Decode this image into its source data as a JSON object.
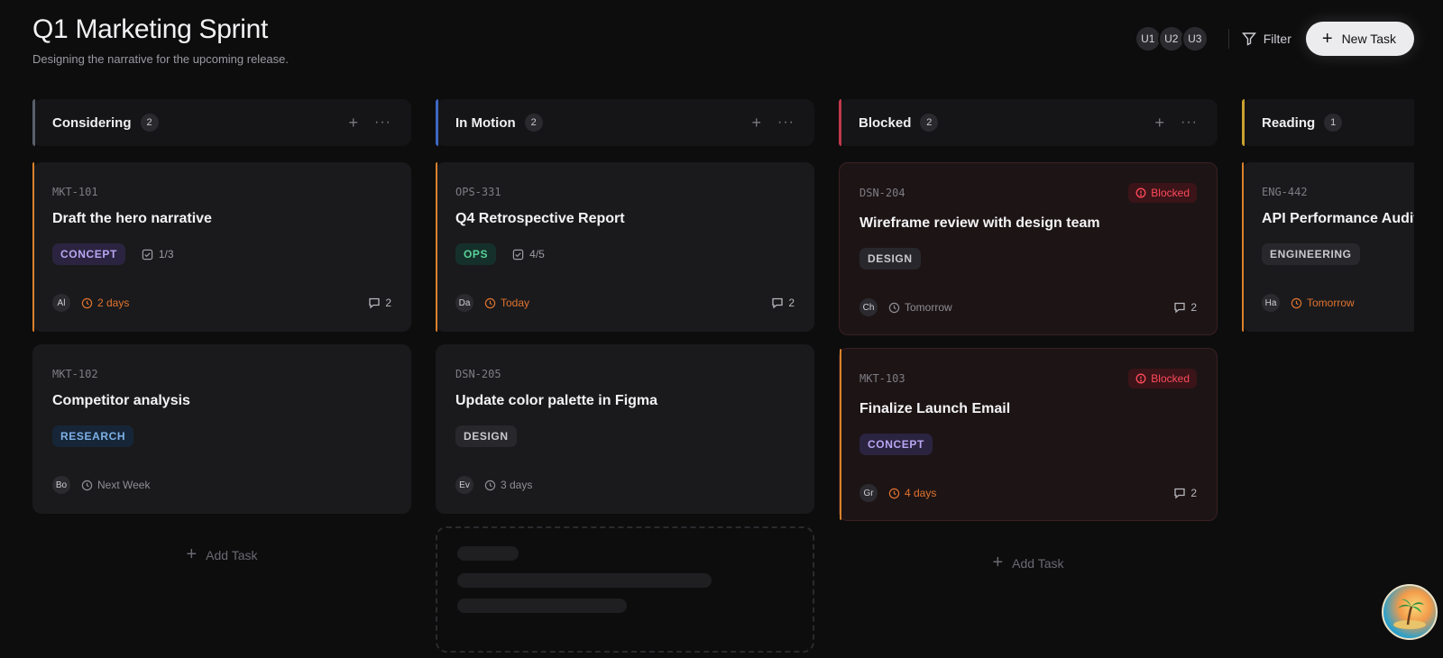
{
  "header": {
    "title": "Q1 Marketing Sprint",
    "subtitle": "Designing the narrative for the upcoming release.",
    "users": [
      "U1",
      "U2",
      "U3"
    ],
    "filter_label": "Filter",
    "new_task_label": "New Task"
  },
  "colors": {
    "considering": "#5b5f6b",
    "in_motion": "#3e68c4",
    "blocked": "#c0394b",
    "reading": "#c9a22f",
    "due_warning": "#e0732f"
  },
  "columns": [
    {
      "title": "Considering",
      "count": "2",
      "add_label": "Add Task",
      "cards": [
        {
          "id": "MKT-101",
          "title": "Draft the hero narrative",
          "tag": "CONCEPT",
          "subtasks": "1/3",
          "assignee": "Al",
          "due": "2 days",
          "comments": "2"
        },
        {
          "id": "MKT-102",
          "title": "Competitor analysis",
          "tag": "RESEARCH",
          "assignee": "Bo",
          "due": "Next Week"
        }
      ]
    },
    {
      "title": "In Motion",
      "count": "2",
      "cards": [
        {
          "id": "OPS-331",
          "title": "Q4 Retrospective Report",
          "tag": "OPS",
          "subtasks": "4/5",
          "assignee": "Da",
          "due": "Today",
          "comments": "2"
        },
        {
          "id": "DSN-205",
          "title": "Update color palette in Figma",
          "tag": "DESIGN",
          "assignee": "Ev",
          "due": "3 days"
        }
      ]
    },
    {
      "title": "Blocked",
      "count": "2",
      "add_label": "Add Task",
      "cards": [
        {
          "id": "DSN-204",
          "title": "Wireframe review with design team",
          "tag": "DESIGN",
          "badge": "Blocked",
          "assignee": "Ch",
          "due": "Tomorrow",
          "comments": "2"
        },
        {
          "id": "MKT-103",
          "title": "Finalize Launch Email",
          "tag": "CONCEPT",
          "badge": "Blocked",
          "assignee": "Gr",
          "due": "4 days",
          "comments": "2"
        }
      ]
    },
    {
      "title": "Reading",
      "count": "1",
      "cards": [
        {
          "id": "ENG-442",
          "title": "API Performance Audit",
          "tag": "ENGINEERING",
          "assignee": "Ha",
          "due": "Tomorrow"
        }
      ]
    }
  ]
}
